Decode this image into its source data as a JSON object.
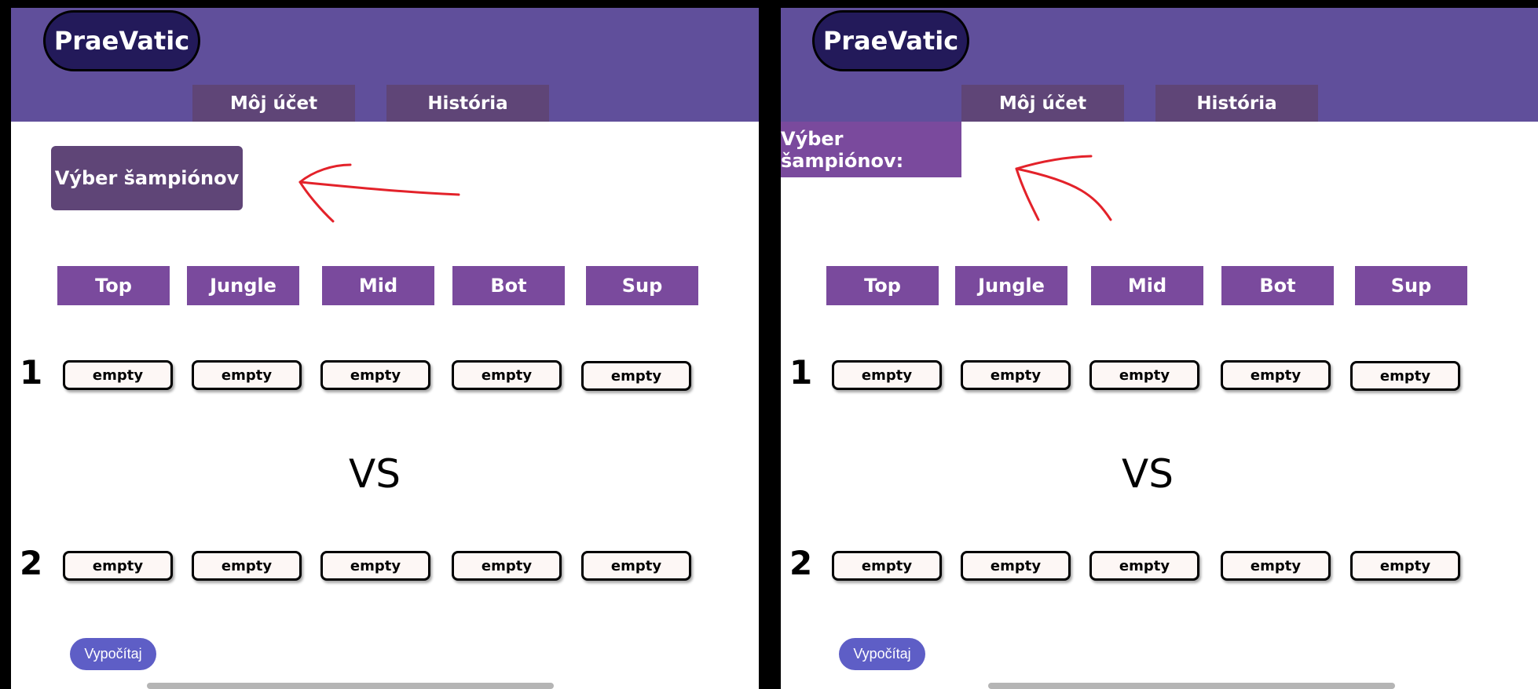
{
  "panels": [
    {
      "logo": "PraeVatic",
      "nav": [
        "Môj účet",
        "História"
      ],
      "champion_button": "Výber šampiónov",
      "roles": [
        "Top",
        "Jungle",
        "Mid",
        "Bot",
        "Sup"
      ],
      "team1": {
        "number": "1",
        "slots": [
          "empty",
          "empty",
          "empty",
          "empty",
          "empty"
        ]
      },
      "versus": "VS",
      "team2": {
        "number": "2",
        "slots": [
          "empty",
          "empty",
          "empty",
          "empty",
          "empty"
        ]
      },
      "calculate_button": "Vypočítaj"
    },
    {
      "logo": "PraeVatic",
      "nav": [
        "Môj účet",
        "História"
      ],
      "champion_button": "Výber šampiónov:",
      "roles": [
        "Top",
        "Jungle",
        "Mid",
        "Bot",
        "Sup"
      ],
      "team1": {
        "number": "1",
        "slots": [
          "empty",
          "empty",
          "empty",
          "empty",
          "empty"
        ]
      },
      "versus": "VS",
      "team2": {
        "number": "2",
        "slots": [
          "empty",
          "empty",
          "empty",
          "empty",
          "empty"
        ]
      },
      "calculate_button": "Vypočítaj"
    }
  ],
  "colors": {
    "header": "#604f9b",
    "logo_bg": "#231a5a",
    "nav_tab": "#5f4577",
    "role_header": "#7a4a9d",
    "champion_button_left": "#5f4577",
    "champion_button_right": "#7a4a9d",
    "calculate_button": "#5e5ec6",
    "annotation_arrow": "#e3222a"
  },
  "annotations": [
    "arrow-pointing-left",
    "arrow-pointing-left"
  ]
}
